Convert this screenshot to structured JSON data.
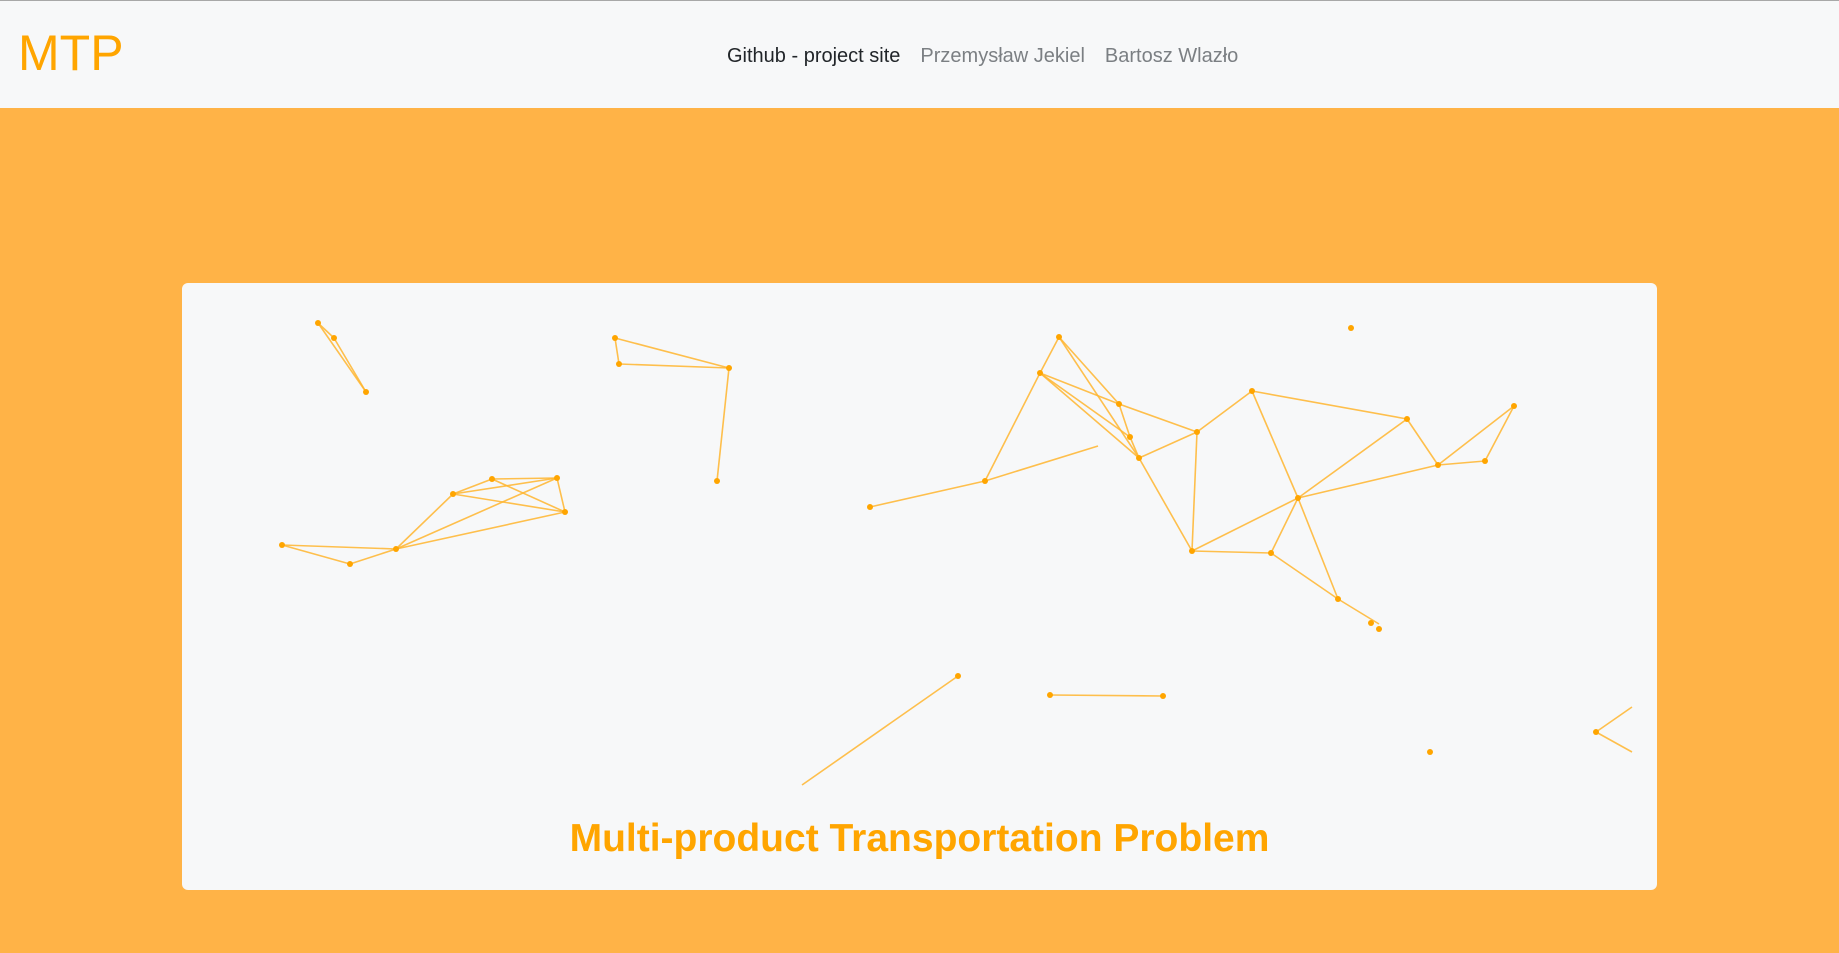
{
  "navbar": {
    "brand": "MTP",
    "links": [
      {
        "label": "Github - project site",
        "active": true
      },
      {
        "label": "Przemysław Jekiel",
        "active": false
      },
      {
        "label": "Bartosz Wlazło",
        "active": false
      }
    ]
  },
  "hero": {
    "title": "Multi-product Transportation Problem"
  },
  "colors": {
    "brand": "#ffa500",
    "hero_background": "#ffb347",
    "navbar_background": "#f7f8f9",
    "card_background": "#f7f8f9",
    "network_line": "#ffb52e"
  }
}
